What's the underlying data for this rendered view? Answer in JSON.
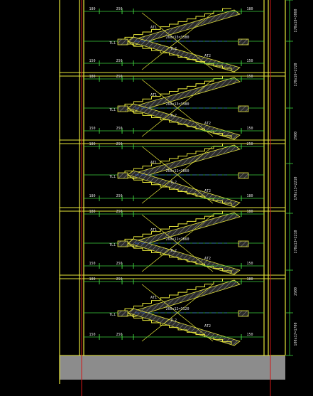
{
  "colors": {
    "background": "#000000",
    "wall": "#e6e63a",
    "stair": "#e6e63a",
    "hatch": "#8a8a8a",
    "dimension": "#3ed23e",
    "tick": "#3ed23e",
    "label": "#e0e0e0",
    "axis": "#d01818",
    "ground": "#8c8c8c",
    "guide": "#3a6fd8"
  },
  "floors": [
    {
      "top_dims": [
        "180",
        "250",
        "180"
      ],
      "bottom_dims": [
        "150",
        "250",
        "150"
      ],
      "stair_label": "260x13=3380",
      "beam_labels": [
        "TL1",
        "TL2"
      ],
      "flight_labels": [
        "AT1",
        "AT2"
      ]
    },
    {
      "top_dims": [
        "180",
        "250",
        "150"
      ],
      "bottom_dims": [
        "150",
        "250",
        "150"
      ],
      "stair_label": "260x13=3380",
      "beam_labels": [
        "TL1",
        "TL2"
      ],
      "flight_labels": [
        "AT1",
        "AT2"
      ]
    },
    {
      "top_dims": [
        "180",
        "250",
        "250"
      ],
      "bottom_dims": [
        "180",
        "250",
        "180"
      ],
      "stair_label": "260x11=2860",
      "beam_labels": [
        "TL1",
        "TL2"
      ],
      "flight_labels": [
        "AT1",
        "AT2"
      ]
    },
    {
      "top_dims": [
        "180",
        "250",
        "180"
      ],
      "bottom_dims": [
        "150",
        "250",
        "150"
      ],
      "stair_label": "260x11=2860",
      "beam_labels": [
        "TL1",
        "TL2"
      ],
      "flight_labels": [
        "AT1",
        "AT2"
      ]
    },
    {
      "top_dims": [
        "180",
        "250",
        "180"
      ],
      "bottom_dims": [
        "150",
        "250",
        "150"
      ],
      "stair_label": "260x12=3120",
      "beam_labels": [
        "TL1",
        "TL2"
      ],
      "flight_labels": [
        "AT1",
        "AT2"
      ]
    }
  ],
  "right_dims": [
    "170x18=3060",
    "170x16=2720",
    "2900",
    "170x13=2210",
    "170x13=2210",
    "2900",
    "100x17=1700"
  ]
}
